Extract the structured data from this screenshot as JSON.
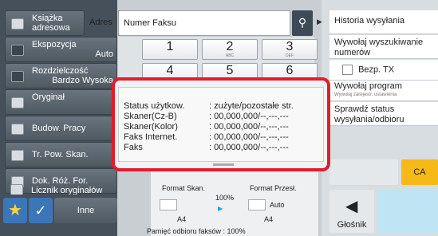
{
  "sidebar": {
    "ksiazka": "Książka adresowa",
    "adres": "Adres",
    "ekspozycja": "Ekspozycja",
    "ekspozycja_value": "Auto",
    "rozdzielczosc": "Rozdzielczość",
    "rozdzielczosc_value": "Bardzo Wysoka",
    "oryginal": "Oryginał",
    "budow": "Budow. Pracy",
    "trpow": "Tr. Pow. Skan.",
    "dokroz": "Dok. Róż. For.",
    "licznik": "Licznik oryginałów",
    "inne": "Inne"
  },
  "fax_field": {
    "label": "Numer Faksu"
  },
  "keypad": [
    {
      "digit": "1",
      "sub": ""
    },
    {
      "digit": "2",
      "sub": "ABC"
    },
    {
      "digit": "3",
      "sub": "DEF"
    },
    {
      "digit": "4",
      "sub": ""
    },
    {
      "digit": "5",
      "sub": ""
    },
    {
      "digit": "6",
      "sub": ""
    }
  ],
  "right_panel": {
    "historia": "Historia wysyłania",
    "wywolaj": "Wywołaj wyszukiwanie numerów",
    "bezp": "Bezp. TX",
    "wywolaj_prog": "Wywołaj program",
    "wywolaj_prog_sub": "Wywołaj zarejestr. ustawienia",
    "sprawdz": "Sprawdź status wysyłania/odbioru",
    "ca": "CA",
    "glosnik": "Głośnik"
  },
  "status": {
    "rows": [
      {
        "key": "Status użytkow.",
        "value": ": zużyte/pozostałe str."
      },
      {
        "key": "Skaner(Cz-B)",
        "value": ": 00,000,000/--,---,---"
      },
      {
        "key": "Skaner(Kolor)",
        "value": ": 00,000,000/--,---,---"
      },
      {
        "key": "Faks Internet.",
        "value": ": 00,000,000/--,---,---"
      },
      {
        "key": "Faks",
        "value": ": 00,000,000/--,---,---"
      }
    ]
  },
  "preview": {
    "format_skan": "Format Skan.",
    "format_przes": "Format Przesł.",
    "percent": "100%",
    "auto": "Auto",
    "a4_left": "A4",
    "a4_right": "A4",
    "memory": "Pamięć odbioru faksów : 100%"
  },
  "colors": {
    "highlight": "#e31c2c",
    "accent_blue": "#3a76b8",
    "ca": "#f6b918"
  }
}
